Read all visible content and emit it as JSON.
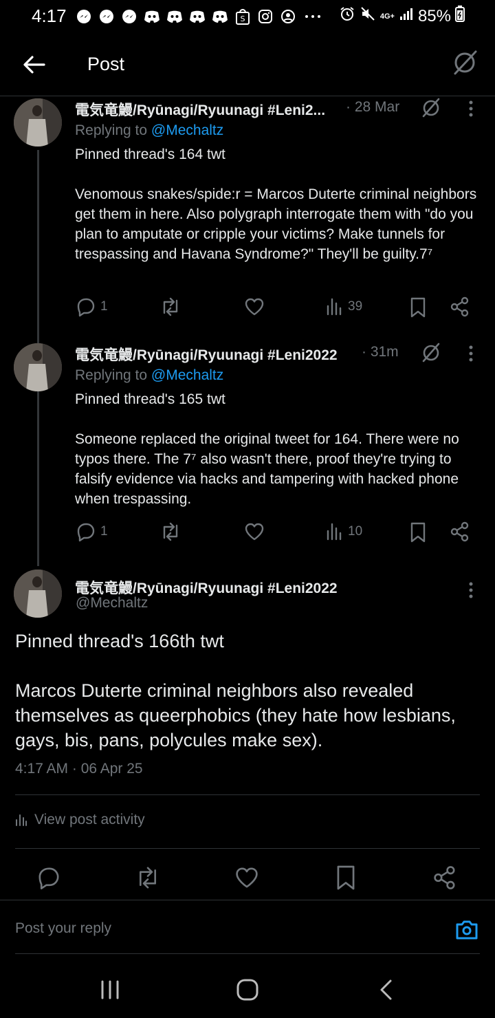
{
  "status_bar": {
    "time": "4:17",
    "network": "4G+",
    "battery": "85%",
    "icons": [
      "messenger-icon",
      "messenger-icon",
      "messenger-icon",
      "discord-icon",
      "discord-icon",
      "discord-icon",
      "discord-icon",
      "shopee-icon",
      "instagram-icon",
      "user-circle-icon",
      "more-icon"
    ],
    "right_icons": [
      "alarm-icon",
      "mute-icon",
      "signal-icon",
      "battery-icon"
    ]
  },
  "header": {
    "title": "Post"
  },
  "replies": [
    {
      "author": "電気竜鰻/Ryūnagi/Ryuunagi #Leni2...",
      "time": "· 28 Mar",
      "replying_label": "Replying to ",
      "mention": "@Mechaltz",
      "text": "Pinned thread's 164 twt\n\nVenomous snakes/spide:r = Marcos Duterte criminal neighbors get them in here. Also polygraph interrogate them with \"do you plan to amputate or cripple your victims? Make tunnels for trespassing and Havana Syndrome?\" They'll be guilty.7⁷",
      "replies_count": "1",
      "views_count": "39"
    },
    {
      "author": "電気竜鰻/Ryūnagi/Ryuunagi #Leni2022",
      "time": "· 31m",
      "replying_label": "Replying to ",
      "mention": "@Mechaltz",
      "text": "Pinned thread's 165 twt\n\nSomeone replaced the original tweet for 164. There were no typos there. The 7⁷ also wasn't there, proof they're trying to falsify evidence via hacks and tampering with hacked phone when trespassing.",
      "replies_count": "1",
      "views_count": "10"
    }
  ],
  "main_post": {
    "author": "電気竜鰻/Ryūnagi/Ryuunagi #Leni2022",
    "handle": "@Mechaltz",
    "text": "Pinned thread's 166th twt\n\nMarcos Duterte criminal neighbors also revealed themselves as queerphobics (they hate how lesbians, gays, bis, pans, polycules make sex).",
    "timestamp": "4:17 AM · 06 Apr 25",
    "view_activity": "View post activity"
  },
  "composer": {
    "placeholder": "Post your reply"
  },
  "colors": {
    "background": "#000000",
    "text": "#e7e9ea",
    "muted": "#71767b",
    "accent": "#1d9bf0",
    "divider": "#2f3336"
  }
}
